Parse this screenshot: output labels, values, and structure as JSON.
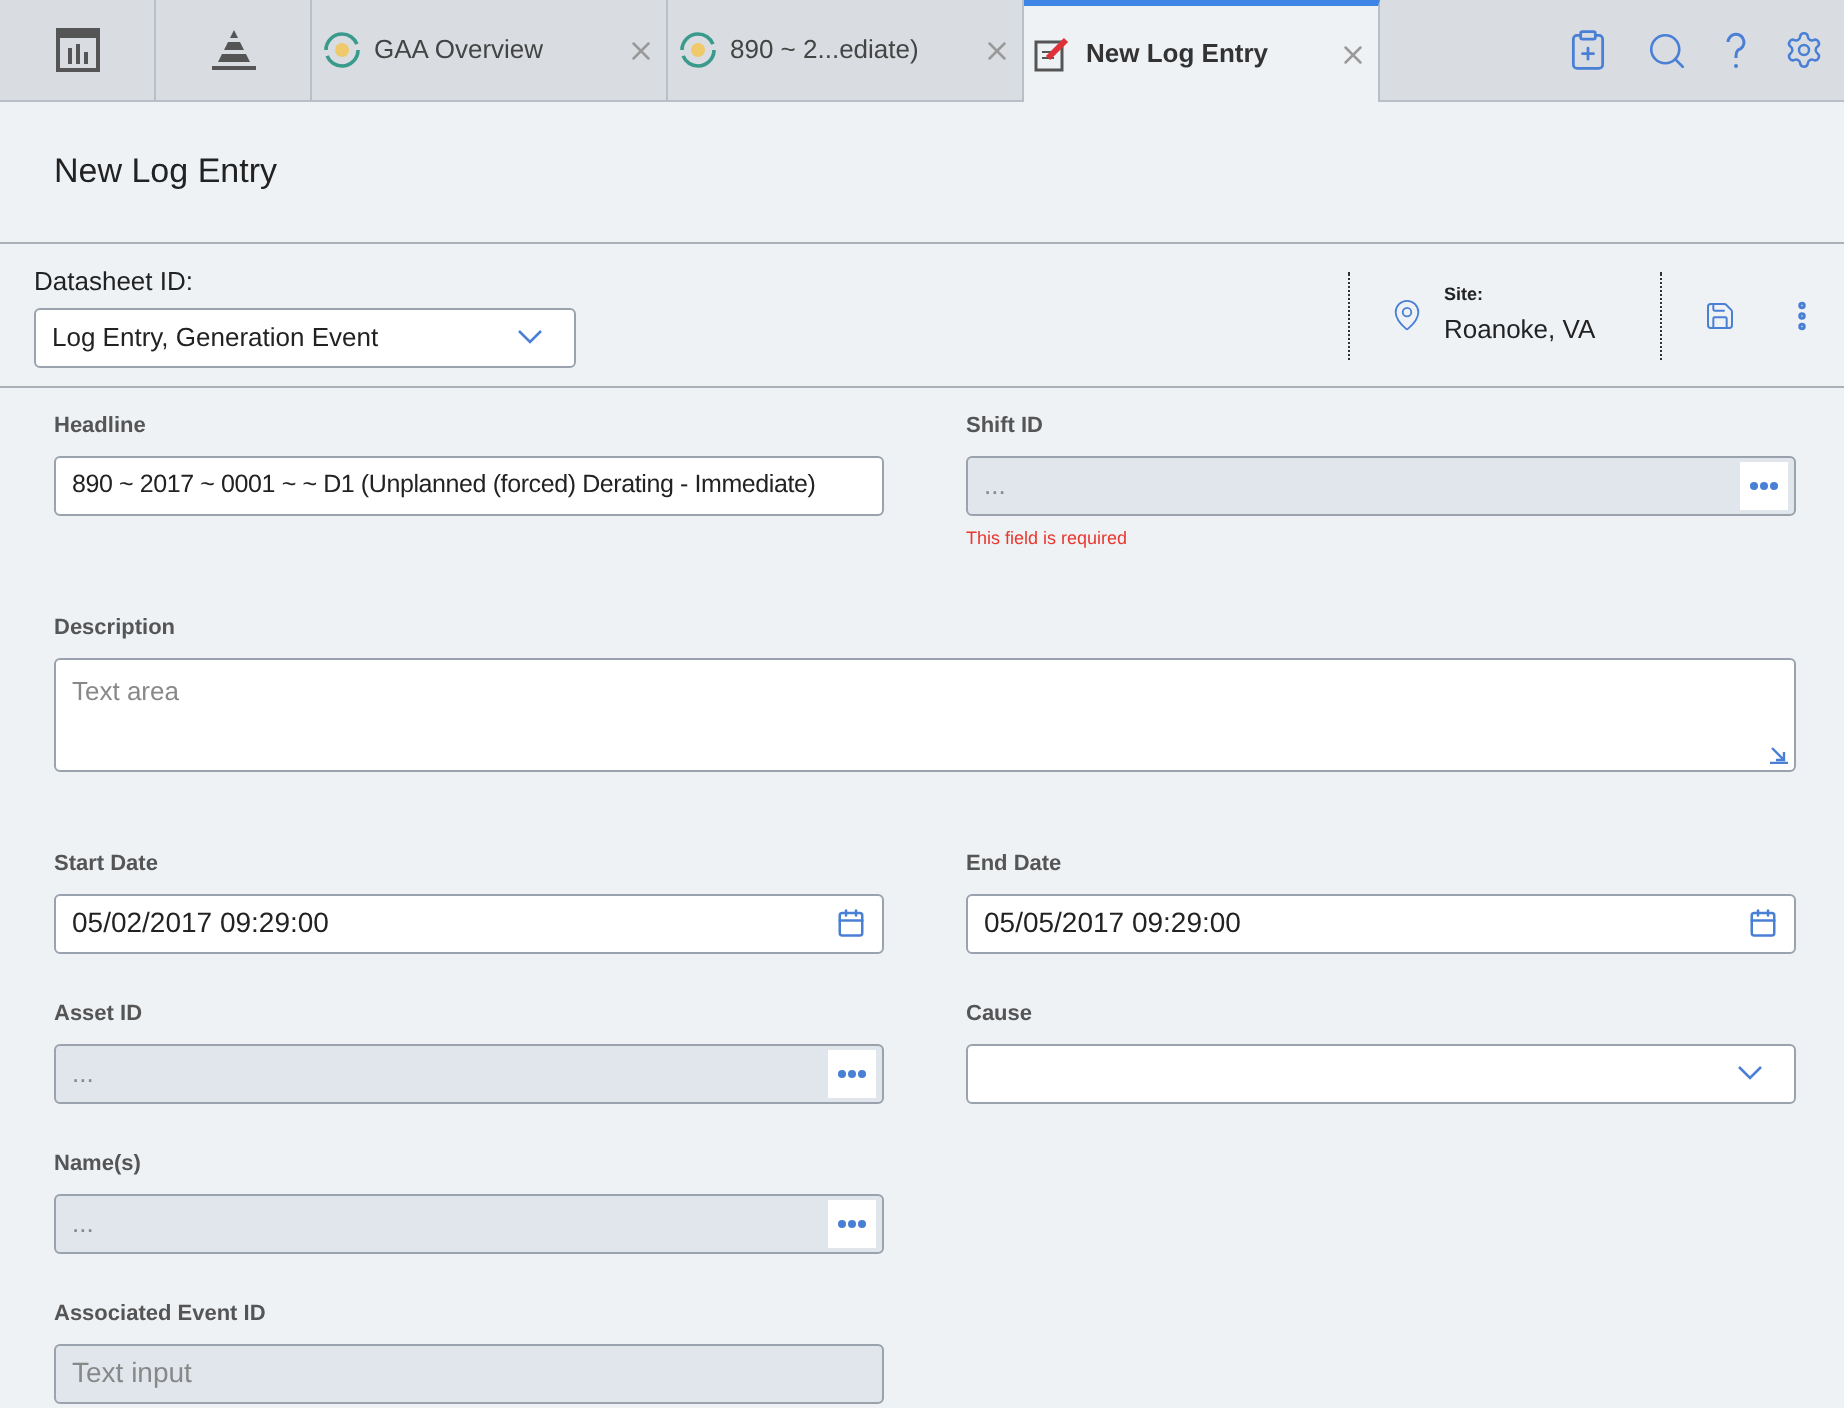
{
  "tabs": [
    {
      "kind": "dashboard",
      "selected": false
    },
    {
      "kind": "pyramid",
      "selected": false
    },
    {
      "kind": "document",
      "label": "GAA Overview",
      "selected": false
    },
    {
      "kind": "document",
      "label": "890 ~ 2...ediate)",
      "selected": false
    },
    {
      "kind": "edit",
      "label": "New Log Entry",
      "selected": true
    }
  ],
  "page_title": "New Log Entry",
  "datasheet": {
    "label": "Datasheet ID:",
    "value": "Log Entry, Generation Event"
  },
  "site": {
    "label": "Site:",
    "value": "Roanoke, VA"
  },
  "rows": [
    [
      {
        "kind": "text",
        "label": "Headline",
        "value": "890 ~ 2017 ~ 0001 ~  ~ D1 (Unplanned (forced) Derating - Immediate)"
      },
      {
        "kind": "lookup",
        "label": "Shift ID",
        "placeholder": "...",
        "error": "This field is required"
      }
    ],
    [
      {
        "kind": "textarea",
        "label": "Description",
        "placeholder": "Text area"
      }
    ],
    [
      {
        "kind": "date",
        "label": "Start Date",
        "value": "05/02/2017 09:29:00"
      },
      {
        "kind": "date",
        "label": "End Date",
        "value": "05/05/2017 09:29:00"
      }
    ],
    [
      {
        "kind": "lookup",
        "label": "Asset ID",
        "placeholder": "..."
      },
      {
        "kind": "select",
        "label": "Cause"
      }
    ],
    [
      {
        "kind": "lookup",
        "label": "Name(s)",
        "placeholder": "..."
      }
    ],
    [
      {
        "kind": "disabled",
        "label": "Associated Event ID",
        "placeholder": "Text input"
      }
    ]
  ]
}
